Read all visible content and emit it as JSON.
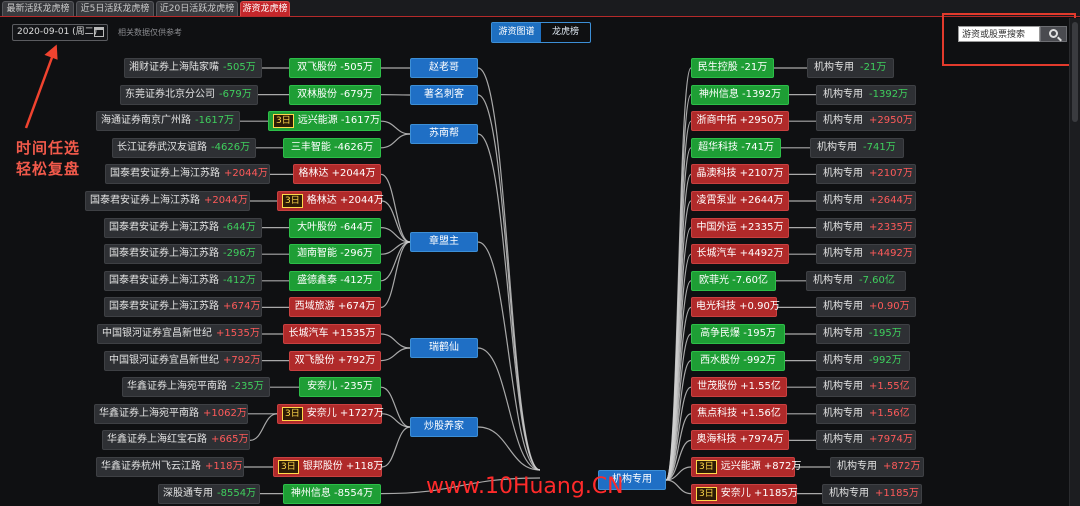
{
  "tabs": [
    {
      "label": "最新活跃龙虎榜"
    },
    {
      "label": "近5日活跃龙虎榜"
    },
    {
      "label": "近20日活跃龙虎榜"
    },
    {
      "label": "游资龙虎榜"
    }
  ],
  "toolbar": {
    "date": "2020-09-01 (周二)",
    "note": "相关数据仅供参考",
    "view_graph": "游资图谱",
    "view_list": "龙虎榜",
    "search_placeholder": "游资或股票搜索"
  },
  "annotation": {
    "line1": "时间任选",
    "line2": "轻松复盘"
  },
  "watermark": "www.10Huang.CN",
  "groups": [
    "赵老哥",
    "著名刺客",
    "苏南帮",
    "章盟主",
    "瑞鹤仙",
    "炒股养家",
    "机构专用"
  ],
  "left_rows": [
    {
      "seat": "湘财证券上海陆家嘴",
      "seat_val": "-505万",
      "stock": "双飞股份 -505万",
      "tag": "",
      "color": "g"
    },
    {
      "seat": "东莞证券北京分公司",
      "seat_val": "-679万",
      "stock": "双林股份 -679万",
      "tag": "",
      "color": "g"
    },
    {
      "seat": "海通证券南京广州路",
      "seat_val": "-1617万",
      "stock": "远兴能源 -1617万",
      "tag": "3日",
      "color": "g"
    },
    {
      "seat": "长江证券武汉友谊路",
      "seat_val": "-4626万",
      "stock": "三丰智能 -4626万",
      "tag": "",
      "color": "g"
    },
    {
      "seat": "国泰君安证券上海江苏路",
      "seat_val": "+2044万",
      "stock": "格林达 +2044万",
      "tag": "",
      "color": "r"
    },
    {
      "seat": "国泰君安证券上海江苏路",
      "seat_val": "+2044万",
      "stock": "格林达 +2044万",
      "tag": "3日",
      "color": "r"
    },
    {
      "seat": "国泰君安证券上海江苏路",
      "seat_val": "-644万",
      "stock": "大叶股份 -644万",
      "tag": "",
      "color": "g"
    },
    {
      "seat": "国泰君安证券上海江苏路",
      "seat_val": "-296万",
      "stock": "迦南智能 -296万",
      "tag": "",
      "color": "g"
    },
    {
      "seat": "国泰君安证券上海江苏路",
      "seat_val": "-412万",
      "stock": "盛德鑫泰 -412万",
      "tag": "",
      "color": "g"
    },
    {
      "seat": "国泰君安证券上海江苏路",
      "seat_val": "+674万",
      "stock": "西域旅游 +674万",
      "tag": "",
      "color": "r"
    },
    {
      "seat": "中国银河证券宜昌新世纪",
      "seat_val": "+1535万",
      "stock": "长城汽车 +1535万",
      "tag": "",
      "color": "r"
    },
    {
      "seat": "中国银河证券宜昌新世纪",
      "seat_val": "+792万",
      "stock": "双飞股份 +792万",
      "tag": "",
      "color": "r"
    },
    {
      "seat": "华鑫证券上海宛平南路",
      "seat_val": "-235万",
      "stock": "安奈儿 -235万",
      "tag": "",
      "color": "g"
    },
    {
      "seat": "华鑫证券上海宛平南路",
      "seat_val": "+1062万",
      "stock": "安奈儿 +1727万",
      "tag": "3日",
      "color": "r"
    },
    {
      "seat": "华鑫证券上海红宝石路",
      "seat_val": "+665万",
      "stock": "",
      "tag": "",
      "color": "r"
    },
    {
      "seat": "华鑫证券杭州飞云江路",
      "seat_val": "+118万",
      "stock": "银邦股份 +118万",
      "tag": "3日",
      "color": "r"
    },
    {
      "seat": "深股通专用",
      "seat_val": "-8554万",
      "stock": "神州信息 -8554万",
      "tag": "",
      "color": "g"
    }
  ],
  "right_rows": [
    {
      "stock": "民生控股 -21万",
      "tag": "",
      "color": "g",
      "inst": "机构专用",
      "inst_val": "-21万"
    },
    {
      "stock": "神州信息 -1392万",
      "tag": "",
      "color": "g",
      "inst": "机构专用",
      "inst_val": "-1392万"
    },
    {
      "stock": "浙商中拓 +2950万",
      "tag": "",
      "color": "r",
      "inst": "机构专用",
      "inst_val": "+2950万"
    },
    {
      "stock": "超华科技 -741万",
      "tag": "",
      "color": "g",
      "inst": "机构专用",
      "inst_val": "-741万"
    },
    {
      "stock": "晶澳科技 +2107万",
      "tag": "",
      "color": "r",
      "inst": "机构专用",
      "inst_val": "+2107万"
    },
    {
      "stock": "凌霄泵业 +2644万",
      "tag": "",
      "color": "r",
      "inst": "机构专用",
      "inst_val": "+2644万"
    },
    {
      "stock": "中国外运 +2335万",
      "tag": "",
      "color": "r",
      "inst": "机构专用",
      "inst_val": "+2335万"
    },
    {
      "stock": "长城汽车 +4492万",
      "tag": "",
      "color": "r",
      "inst": "机构专用",
      "inst_val": "+4492万"
    },
    {
      "stock": "欧菲光 -7.60亿",
      "tag": "",
      "color": "g",
      "inst": "机构专用",
      "inst_val": "-7.60亿"
    },
    {
      "stock": "电光科技 +0.90万",
      "tag": "",
      "color": "r",
      "inst": "机构专用",
      "inst_val": "+0.90万"
    },
    {
      "stock": "高争民爆 -195万",
      "tag": "",
      "color": "g",
      "inst": "机构专用",
      "inst_val": "-195万"
    },
    {
      "stock": "西水股份 -992万",
      "tag": "",
      "color": "g",
      "inst": "机构专用",
      "inst_val": "-992万"
    },
    {
      "stock": "世茂股份 +1.55亿",
      "tag": "",
      "color": "r",
      "inst": "机构专用",
      "inst_val": "+1.55亿"
    },
    {
      "stock": "焦点科技 +1.56亿",
      "tag": "",
      "color": "r",
      "inst": "机构专用",
      "inst_val": "+1.56亿"
    },
    {
      "stock": "奥海科技 +7974万",
      "tag": "",
      "color": "r",
      "inst": "机构专用",
      "inst_val": "+7974万"
    },
    {
      "stock": "远兴能源 +872万",
      "tag": "3日",
      "color": "r",
      "inst": "机构专用",
      "inst_val": "+872万"
    },
    {
      "stock": "安奈儿 +1185万",
      "tag": "3日",
      "color": "r",
      "inst": "机构专用",
      "inst_val": "+1185万"
    }
  ]
}
